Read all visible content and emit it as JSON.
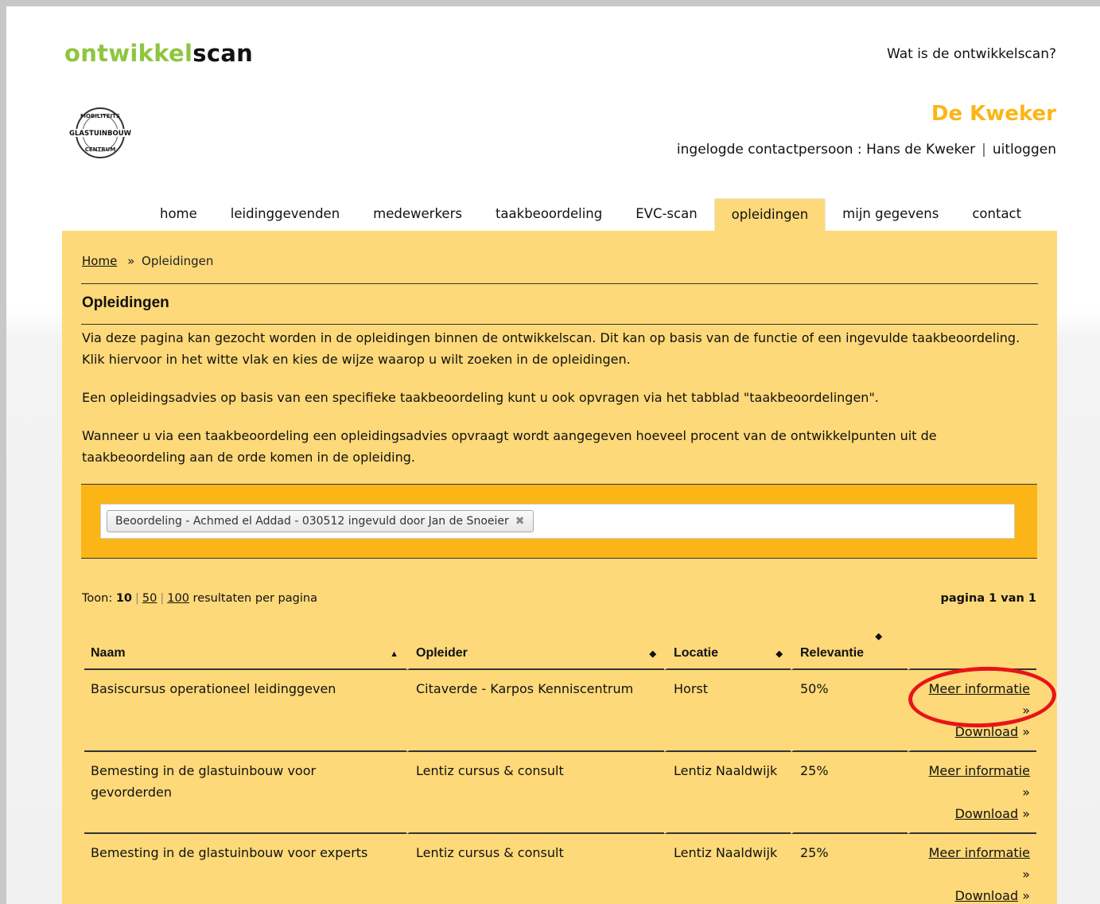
{
  "header": {
    "logo_part1": "ontwikkel",
    "logo_part2": "scan",
    "what_is_link": "Wat is de ontwikkelscan?",
    "company": "De Kweker",
    "user_prefix": "ingelogde contactpersoon : Hans de Kweker",
    "separator": "|",
    "logout": "uitloggen",
    "badge_text_top": "MOBILITEITS",
    "badge_text_mid": "GLASTUINBOUW",
    "badge_text_bottom": "CENTRUM"
  },
  "nav": {
    "tabs": [
      {
        "label": "home"
      },
      {
        "label": "leidinggevenden"
      },
      {
        "label": "medewerkers"
      },
      {
        "label": "taakbeoordeling"
      },
      {
        "label": "EVC-scan"
      },
      {
        "label": "opleidingen",
        "active": true
      },
      {
        "label": "mijn gegevens"
      },
      {
        "label": "contact"
      }
    ]
  },
  "breadcrumb": {
    "home": "Home",
    "sep": "»",
    "current": "Opleidingen"
  },
  "page": {
    "title": "Opleidingen",
    "para1": "Via deze pagina kan gezocht worden in de opleidingen binnen de ontwikkelscan. Dit kan op basis van de functie of een ingevulde taakbeoordeling. Klik hiervoor in het witte vlak en kies de wijze waarop u wilt zoeken in de opleidingen.",
    "para2": "Een opleidingsadvies op basis van een specifieke taakbeoordeling kunt u ook opvragen via het tabblad \"taakbeoordelingen\".",
    "para3": "Wanneer u via een taakbeoordeling een opleidingsadvies opvraagt wordt aangegeven hoeveel procent van de ontwikkelpunten uit de taakbeoordeling aan de orde komen in de opleiding."
  },
  "search": {
    "chip": "Beoordeling - Achmed el Addad - 030512 ingevuld door Jan de Snoeier",
    "remove": "✖"
  },
  "pager": {
    "toon_label": "Toon:",
    "opt_current": "10",
    "opt_50": "50",
    "opt_100": "100",
    "bar": "|",
    "suffix": "resultaten per pagina",
    "page_info": "pagina 1 van 1"
  },
  "table": {
    "headers": {
      "naam": "Naam",
      "opleider": "Opleider",
      "locatie": "Locatie",
      "relevantie": "Relevantie"
    },
    "rows": [
      {
        "naam": "Basiscursus operationeel leidinggeven",
        "opleider": "Citaverde - Karpos Kenniscentrum",
        "locatie": "Horst",
        "relevantie": "50%"
      },
      {
        "naam": "Bemesting in de glastuinbouw voor gevorderden",
        "opleider": "Lentiz cursus & consult",
        "locatie": "Lentiz Naaldwijk",
        "relevantie": "25%"
      },
      {
        "naam": "Bemesting in de glastuinbouw voor experts",
        "opleider": "Lentiz cursus & consult",
        "locatie": "Lentiz Naaldwijk",
        "relevantie": "25%"
      }
    ],
    "meer_informatie": "Meer informatie",
    "download": "Download",
    "arrow": "»"
  },
  "colors": {
    "accent_yellow": "#fbb516",
    "panel": "#fed979",
    "logo_green": "#8dc63f",
    "highlight_red": "#e8141a"
  }
}
